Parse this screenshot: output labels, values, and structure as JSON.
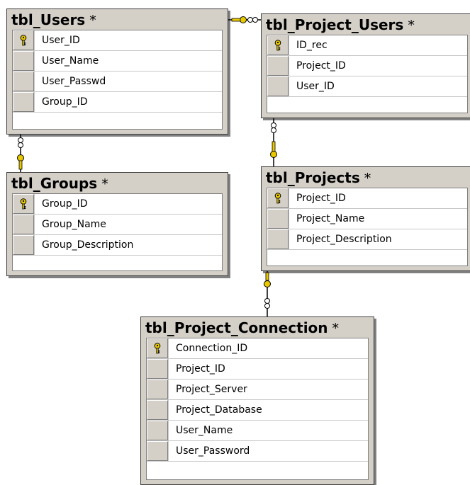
{
  "tables": [
    {
      "id": "users",
      "name": "tbl_Users",
      "marker": "*",
      "fields": [
        {
          "name": "User_ID",
          "primary_key": true
        },
        {
          "name": "User_Name",
          "primary_key": false
        },
        {
          "name": "User_Passwd",
          "primary_key": false
        },
        {
          "name": "Group_ID",
          "primary_key": false
        }
      ]
    },
    {
      "id": "project-users",
      "name": "tbl_Project_Users",
      "marker": "*",
      "fields": [
        {
          "name": "ID_rec",
          "primary_key": true
        },
        {
          "name": "Project_ID",
          "primary_key": false
        },
        {
          "name": "User_ID",
          "primary_key": false
        }
      ]
    },
    {
      "id": "groups",
      "name": "tbl_Groups",
      "marker": "*",
      "fields": [
        {
          "name": "Group_ID",
          "primary_key": true
        },
        {
          "name": "Group_Name",
          "primary_key": false
        },
        {
          "name": "Group_Description",
          "primary_key": false
        }
      ]
    },
    {
      "id": "projects",
      "name": "tbl_Projects",
      "marker": "*",
      "fields": [
        {
          "name": "Project_ID",
          "primary_key": true
        },
        {
          "name": "Project_Name",
          "primary_key": false
        },
        {
          "name": "Project_Description",
          "primary_key": false
        }
      ]
    },
    {
      "id": "project-connection",
      "name": "tbl_Project_Connection",
      "marker": "*",
      "fields": [
        {
          "name": "Connection_ID",
          "primary_key": true
        },
        {
          "name": "Project_ID",
          "primary_key": false
        },
        {
          "name": "Project_Server",
          "primary_key": false
        },
        {
          "name": "Project_Database",
          "primary_key": false
        },
        {
          "name": "User_Name",
          "primary_key": false
        },
        {
          "name": "User_Password",
          "primary_key": false
        }
      ]
    }
  ],
  "relationships": [
    {
      "one": "users",
      "many": "project-users"
    },
    {
      "one": "groups",
      "many": "users"
    },
    {
      "one": "projects",
      "many": "project-users"
    },
    {
      "one": "projects",
      "many": "project-connection"
    }
  ],
  "colors": {
    "key": "#e8c800",
    "link": "#000000",
    "header": "#d4d0c8"
  }
}
